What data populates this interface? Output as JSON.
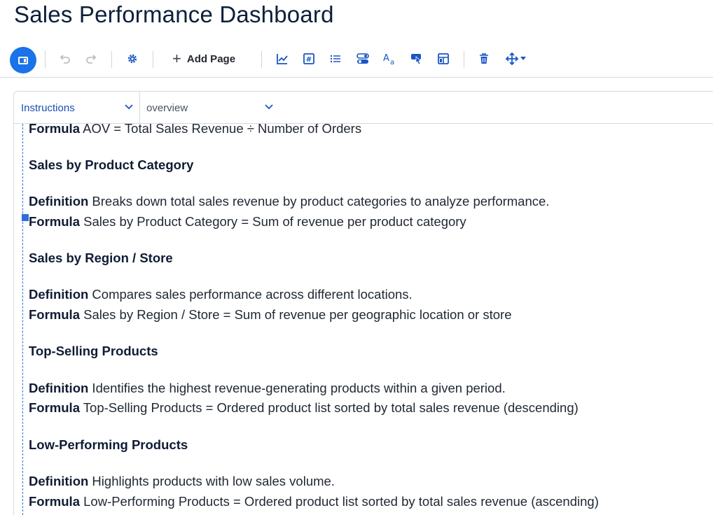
{
  "app": {
    "title": "Sales Performance Dashboard"
  },
  "toolbar": {
    "add_page_label": "Add Page",
    "icons": [
      "panel-toggle-icon",
      "undo-icon",
      "redo-icon",
      "settings-gear-icon",
      "plus-icon",
      "line-chart-icon",
      "number-card-icon",
      "list-icon",
      "toggle-icon",
      "text-style-icon",
      "touch-button-icon",
      "layout-icon",
      "trash-icon",
      "move-icon",
      "chevron-down-icon"
    ]
  },
  "tabs": {
    "instructions": "Instructions",
    "overview": "overview"
  },
  "content": {
    "partial_line": {
      "label": "Formula",
      "text": " AOV = Total Sales Revenue ÷ Number of Orders"
    },
    "sections": [
      {
        "heading": "Sales by Product Category",
        "definition_label": "Definition",
        "definition": " Breaks down total sales revenue by product categories to analyze performance.",
        "formula_label": "Formula",
        "formula": " Sales by Product Category = Sum of revenue per product category"
      },
      {
        "heading": "Sales by Region / Store",
        "definition_label": "Definition",
        "definition": " Compares sales performance across different locations.",
        "formula_label": "Formula",
        "formula": " Sales by Region / Store = Sum of revenue per geographic location or store"
      },
      {
        "heading": "Top-Selling Products",
        "definition_label": "Definition",
        "definition": " Identifies the highest revenue-generating products within a given period.",
        "formula_label": "Formula",
        "formula": " Top-Selling Products = Ordered product list sorted by total sales revenue (descending)"
      },
      {
        "heading": "Low-Performing Products",
        "definition_label": "Definition",
        "definition": " Highlights products with low sales volume.",
        "formula_label": "Formula",
        "formula": " Low-Performing Products = Ordered product list sorted by total sales revenue (ascending)"
      }
    ]
  },
  "colors": {
    "accent": "#1a73e8",
    "tab_active": "#1a4fb5",
    "guide": "#2f6ed8"
  }
}
